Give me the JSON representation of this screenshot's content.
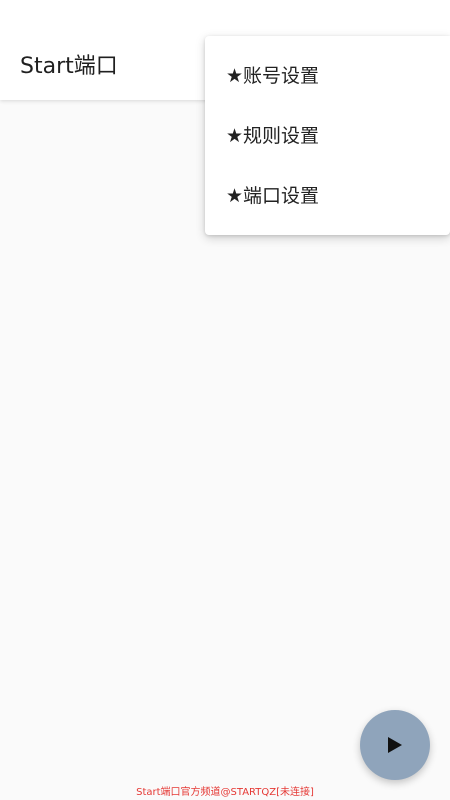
{
  "app_bar": {
    "title": "Start端口"
  },
  "menu": {
    "items": [
      {
        "label": "★账号设置"
      },
      {
        "label": "★规则设置"
      },
      {
        "label": "★端口设置"
      }
    ]
  },
  "fab": {
    "icon": "play-icon",
    "color": "#8fa4bb"
  },
  "footer": {
    "text": "Start端口官方频道@STARTQZ[未连接]",
    "color": "#e53935"
  }
}
